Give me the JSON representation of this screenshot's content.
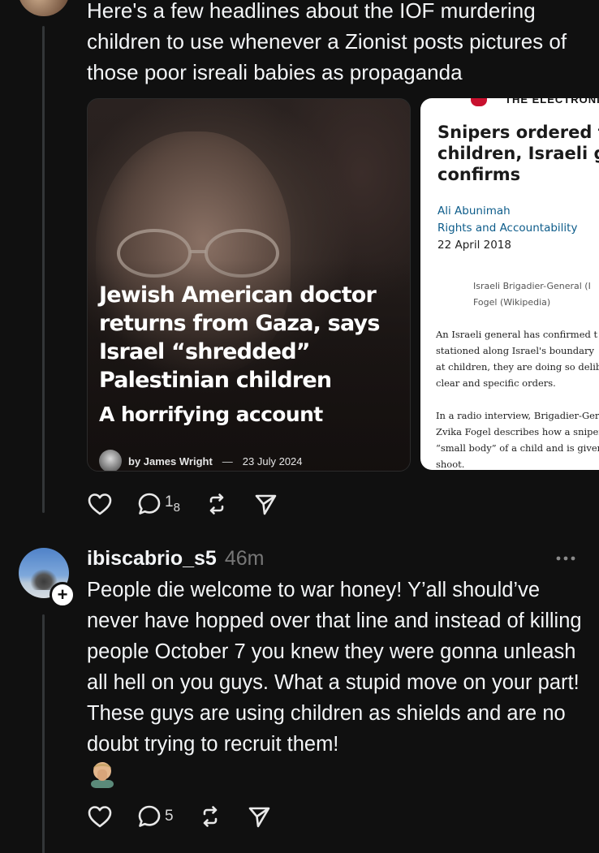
{
  "post": {
    "text": "Here's a few headlines about the IOF murdering children to use whenever a Zionist posts pictures of those poor isreali babies as propaganda",
    "cards": [
      {
        "headline": "Jewish American doctor returns from Gaza, says Israel “shredded” Palestinian children",
        "subhead": "A horrifying account",
        "byline": {
          "author": "by James Wright",
          "dash": "—",
          "date": "23 July 2024"
        }
      },
      {
        "masthead": "THE ELECTRONIC",
        "title": "Snipers ordered t\nchildren, Israeli g\nconfirms",
        "author": "Ali Abunimah",
        "section": "Rights and Accountability",
        "date": "22 April 2018",
        "caption": "Israeli Brigadier-General (I\nFogel (Wikipedia)",
        "paragraph1": "An Israeli general has confirmed t\nstationed along Israel's boundary\nat children, they are doing so delib\nclear and specific orders.",
        "paragraph2": "In a radio interview, Brigadier-Ger\nZvika Fogel describes how a sniper\n“small body” of a child and is given\nshoot."
      }
    ],
    "actions": {
      "reply_count": "1",
      "reply_count_sub": "8"
    }
  },
  "reply": {
    "username": "ibiscabrio_s5",
    "timestamp": "46m",
    "text": "People die welcome to war honey! Y’all should’ve never have hopped over that line and instead of killing people October 7 you knew they were gonna unleash all hell on you guys. What a stupid move on your part!  These guys are using children as shields and are no doubt trying to recruit them!",
    "emoji": "man-facepalming-emoji",
    "follow_glyph": "+",
    "actions": {
      "reply_count": "5"
    }
  },
  "colors": {
    "background": "#101010",
    "text": "#f3f5f7",
    "muted": "#777777",
    "thread_line": "#333638",
    "link_blue": "#0d5c8a"
  },
  "icons": [
    "heart-icon",
    "comment-icon",
    "repost-icon",
    "share-icon",
    "more-icon",
    "follow-plus-icon"
  ]
}
